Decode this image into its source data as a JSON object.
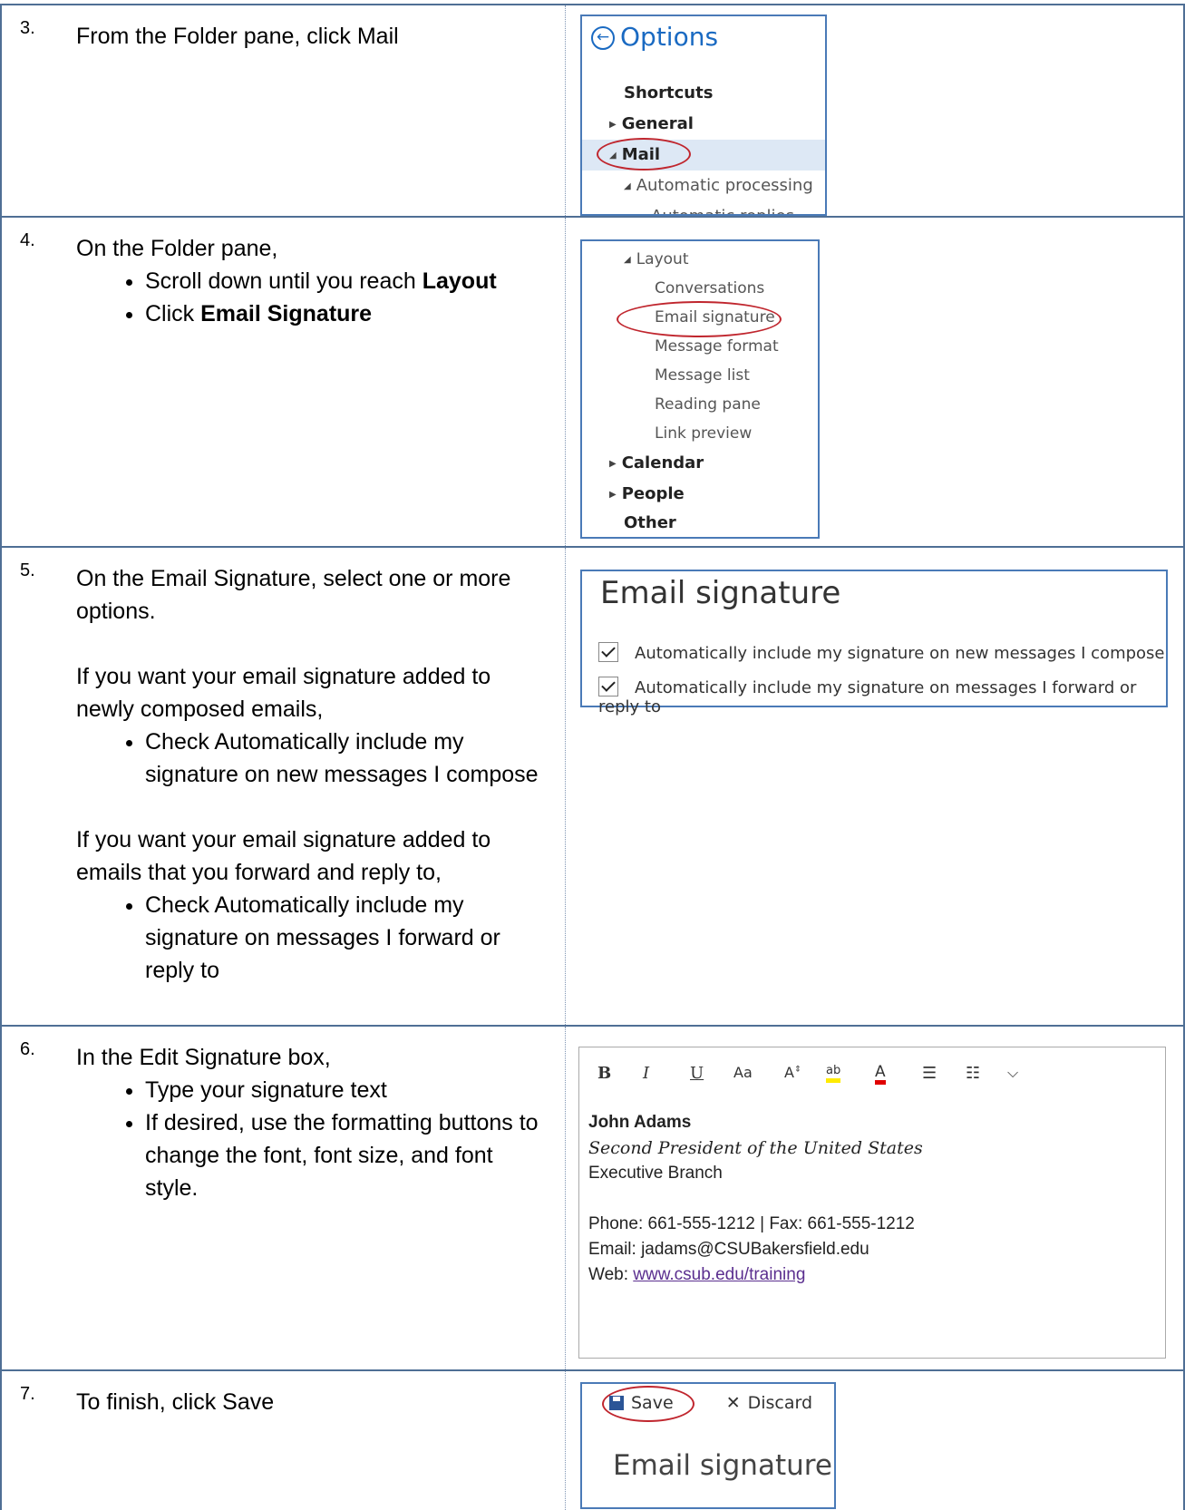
{
  "steps": [
    {
      "num": "3.",
      "text": "From the Folder pane, click Mail"
    },
    {
      "num": "4.",
      "intro": "On the Folder pane,",
      "b1_pre": "Scroll down until you reach ",
      "b1_bold": "Layout",
      "b2_pre": "Click ",
      "b2_bold": "Email Signature"
    },
    {
      "num": "5.",
      "intro": "On the Email Signature, select one or more options.",
      "p2": "If you want your email signature added to newly composed emails,",
      "b1": "Check Automatically include my signature on new messages I compose",
      "p3": "If you want your email signature added to emails that you forward and reply to,",
      "b2": "Check Automatically include my signature on messages I forward or reply to"
    },
    {
      "num": "6.",
      "intro": "In the Edit Signature box,",
      "b1": "Type your signature text",
      "b2": "If desired, use the formatting buttons to change the font, font size, and font style."
    },
    {
      "num": "7.",
      "text": "To finish, click Save"
    }
  ],
  "options_shot": {
    "back_glyph": "←",
    "title": "Options",
    "items": [
      "Shortcuts",
      "General",
      "Mail",
      "Automatic processing",
      "Automatic replies"
    ]
  },
  "folder_shot": {
    "layout": "Layout",
    "sub": [
      "Conversations",
      "Email signature",
      "Message format",
      "Message list",
      "Reading pane",
      "Link preview"
    ],
    "calendar": "Calendar",
    "people": "People",
    "other": "Other"
  },
  "signature_shot": {
    "title": "Email signature",
    "opt1": "Automatically include my signature on new messages I compose",
    "opt2": "Automatically include my signature on messages I forward or reply to"
  },
  "editor_shot": {
    "toolbar": [
      "B",
      "I",
      "U",
      "Aa",
      "A",
      "ab",
      "A",
      "list",
      "numlist",
      "more"
    ],
    "name": "John Adams",
    "title": "Second President of the United States",
    "branch": "Executive Branch",
    "phone": "Phone: 661-555-1212 | Fax: 661-555-1212",
    "email": "Email: jadams@CSUBakersfield.edu",
    "web_label": "Web: ",
    "web_link": "www.csub.edu/training",
    "highlight_color": "#ffeb00",
    "font_color": "#e00000"
  },
  "save_shot": {
    "save": "Save",
    "discard": "Discard",
    "title": "Email signature"
  }
}
